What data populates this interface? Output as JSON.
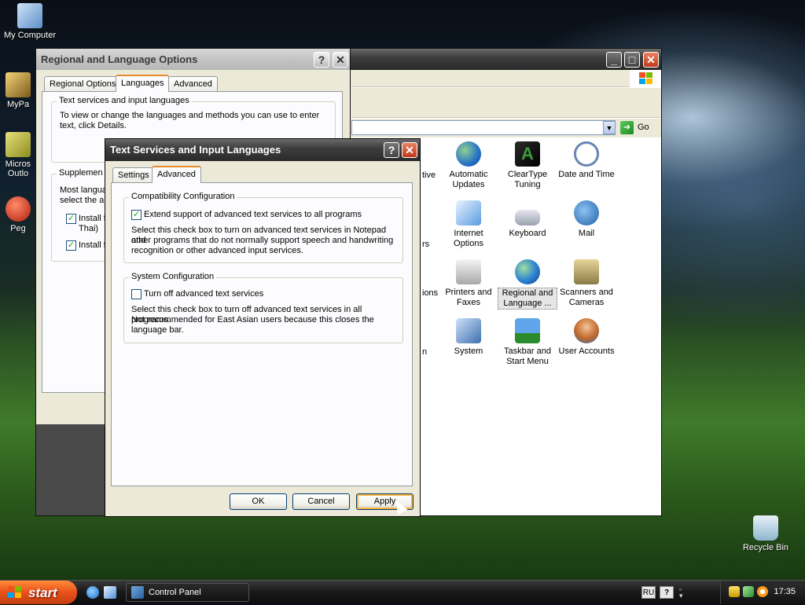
{
  "desktop": {
    "icons": [
      {
        "label": "My Computer"
      },
      {
        "label": "MyPa"
      },
      {
        "label": "Micros"
      },
      {
        "label": "Outlo"
      },
      {
        "label": "Peg"
      },
      {
        "label": "Recycle Bin"
      }
    ]
  },
  "control_panel": {
    "go_label": "Go",
    "partial_labels": [
      "tive",
      "rs",
      "ions",
      "n"
    ],
    "items": [
      {
        "label1": "Automatic",
        "label2": "Updates",
        "icon": "globe-shield-icon"
      },
      {
        "label1": "ClearType",
        "label2": "Tuning",
        "icon": "cleartype-icon"
      },
      {
        "label1": "Date and Time",
        "label2": "",
        "icon": "clock-icon"
      },
      {
        "label1": "Internet",
        "label2": "Options",
        "icon": "internet-icon"
      },
      {
        "label1": "Keyboard",
        "label2": "",
        "icon": "keyboard-icon"
      },
      {
        "label1": "Mail",
        "label2": "",
        "icon": "mail-icon"
      },
      {
        "label1": "Printers and",
        "label2": "Faxes",
        "icon": "printer-icon"
      },
      {
        "label1": "Regional and",
        "label2": "Language ...",
        "icon": "globe-icon"
      },
      {
        "label1": "Scanners and",
        "label2": "Cameras",
        "icon": "scanner-icon"
      },
      {
        "label1": "System",
        "label2": "",
        "icon": "system-icon"
      },
      {
        "label1": "Taskbar and",
        "label2": "Start Menu",
        "icon": "taskbar-icon"
      },
      {
        "label1": "User Accounts",
        "label2": "",
        "icon": "users-icon"
      }
    ]
  },
  "regional": {
    "title": "Regional and Language Options",
    "tabs": [
      "Regional Options",
      "Languages",
      "Advanced"
    ],
    "group1_title": "Text services and input languages",
    "group1_text1": "To view or change the languages and methods you can use to enter",
    "group1_text2": "text, click Details.",
    "group2_title": "Supplemen",
    "group2_text1": "Most langua",
    "group2_text2": "select the ap",
    "check1_a": "Install fi",
    "check1_b": "Thai)",
    "check2": "Install fi"
  },
  "tsi": {
    "title": "Text Services and Input Languages",
    "tabs": [
      "Settings",
      "Advanced"
    ],
    "compat_title": "Compatibility Configuration",
    "compat_check": "Extend support of advanced text services to all programs",
    "compat_desc1": "Select this check box to turn on advanced text services in Notepad and",
    "compat_desc2": "other programs that do not normally support speech and handwriting",
    "compat_desc3": "recognition or other advanced input services.",
    "sys_title": "System Configuration",
    "sys_check": "Turn off advanced text services",
    "sys_desc1": "Select this check box to turn off advanced text services in all programs.",
    "sys_desc2": "Not recommended for East Asian users because this closes the",
    "sys_desc3": "language bar.",
    "ok": "OK",
    "cancel": "Cancel",
    "apply": "Apply"
  },
  "taskbar": {
    "start": "start",
    "task": "Control Panel",
    "lang": "RU",
    "help": "?",
    "clock": "17:35"
  }
}
